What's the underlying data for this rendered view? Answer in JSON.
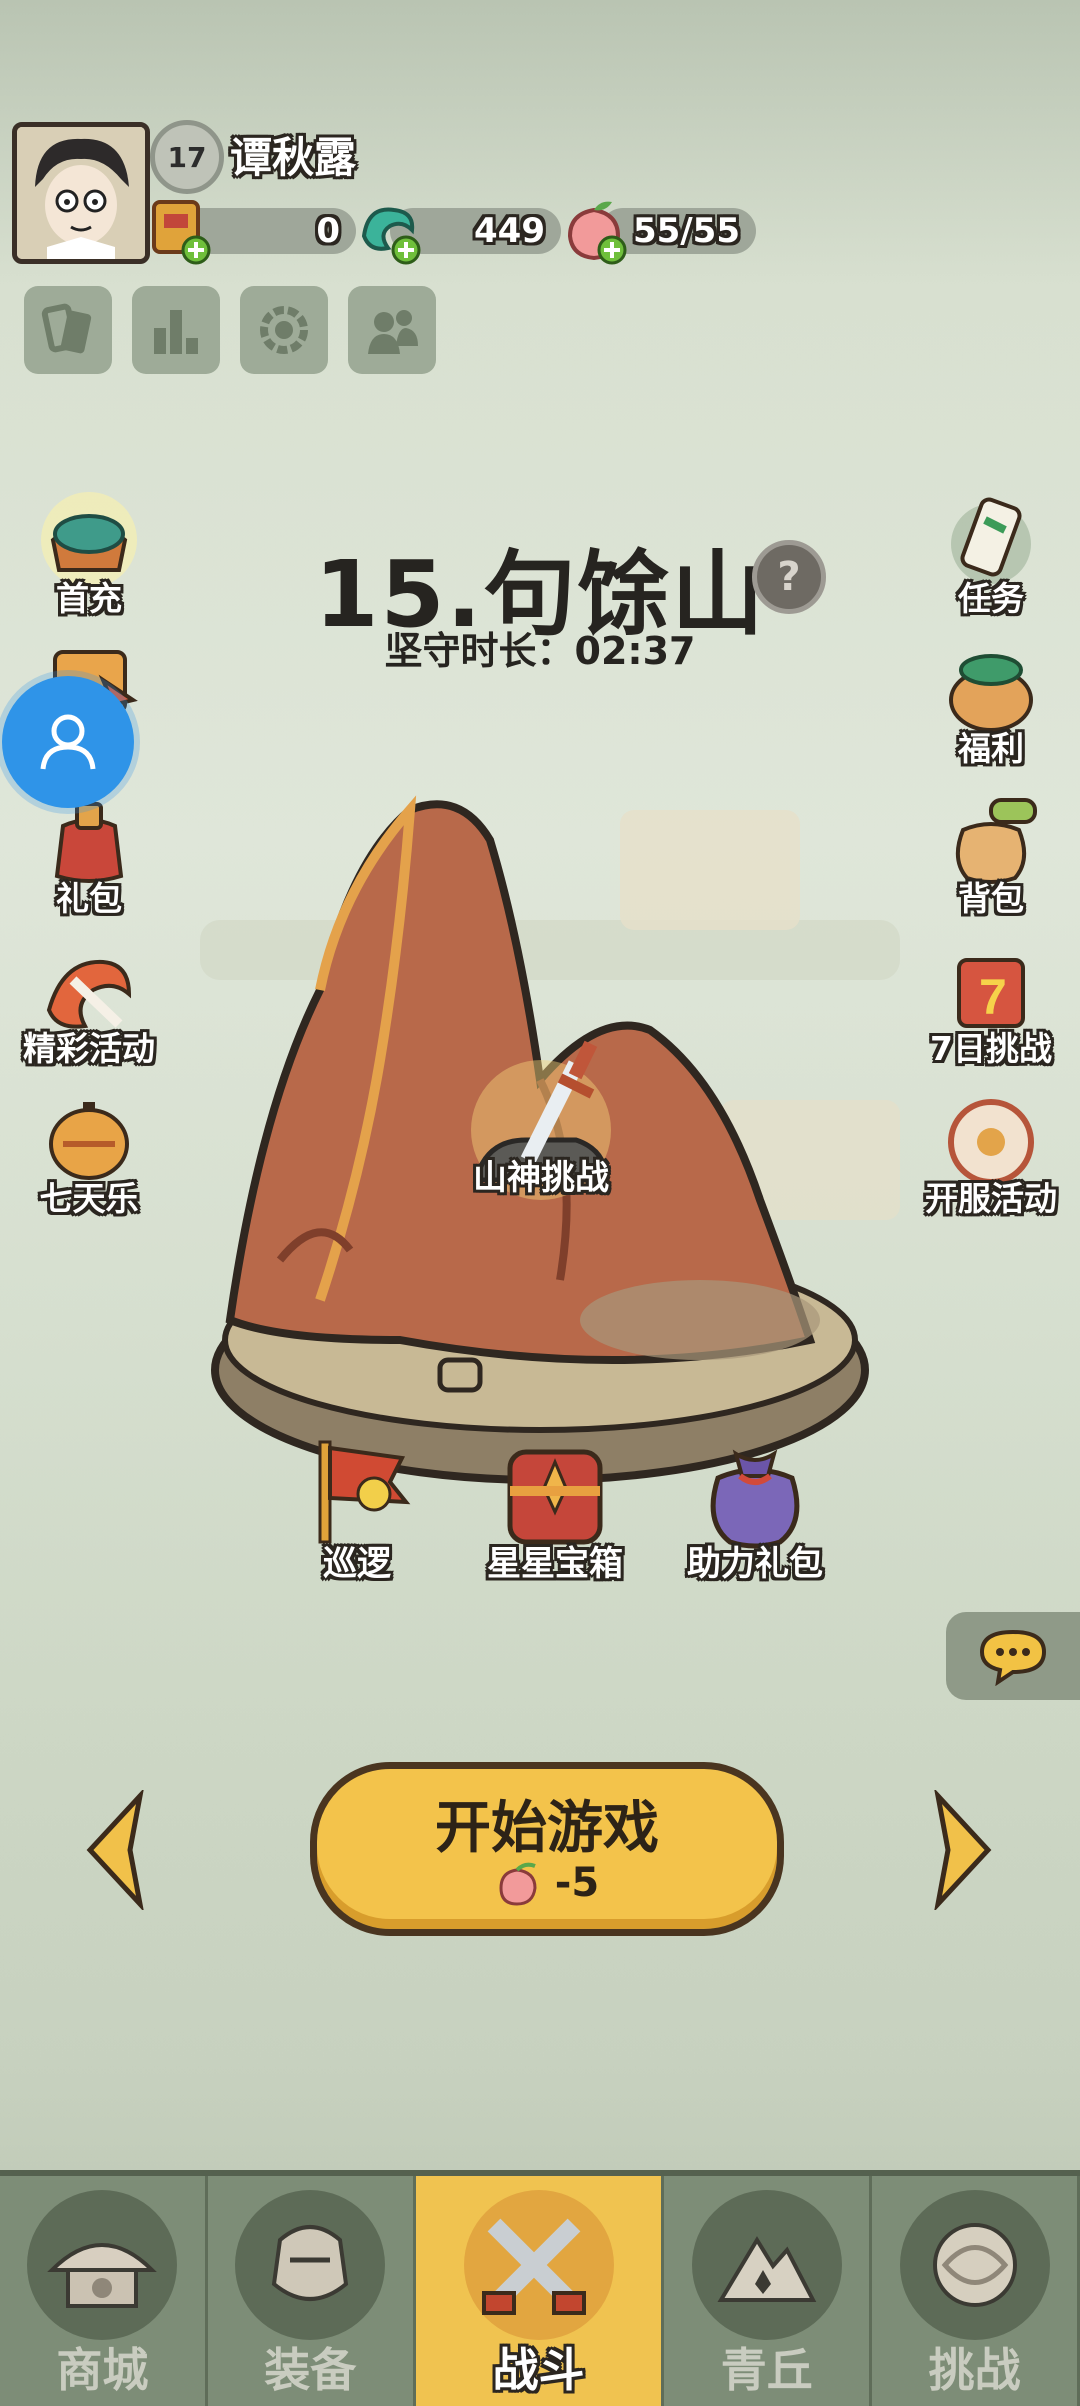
{
  "player": {
    "level": "17",
    "name": "谭秋露"
  },
  "resources": [
    {
      "icon": "gold-ticket-icon",
      "value": "0"
    },
    {
      "icon": "jade-dragon-icon",
      "value": "449"
    },
    {
      "icon": "peach-stamina-icon",
      "value": "55/55"
    }
  ],
  "tools": [
    "cards-icon",
    "ranking-icon",
    "settings-icon",
    "friends-icon"
  ],
  "left_menu": [
    {
      "label": "首充",
      "icon": "first-recharge-icon"
    },
    {
      "label": "",
      "icon": "event-icon"
    },
    {
      "label": "礼包",
      "icon": "gift-bag-icon"
    },
    {
      "label": "精彩活动",
      "icon": "activities-icon"
    },
    {
      "label": "七天乐",
      "icon": "seven-day-icon"
    }
  ],
  "right_menu": [
    {
      "label": "任务",
      "icon": "task-scroll-icon"
    },
    {
      "label": "福利",
      "icon": "welfare-icon"
    },
    {
      "label": "背包",
      "icon": "backpack-icon"
    },
    {
      "label": "7日挑战",
      "icon": "seven-day-challenge-icon"
    },
    {
      "label": "开服活动",
      "icon": "server-event-icon"
    }
  ],
  "stage": {
    "title": "15.句馀山",
    "timer_label": "坚守时长：",
    "timer_value": "02:37",
    "challenge_label": "山神挑战"
  },
  "bottom_items": [
    {
      "label": "巡逻",
      "icon": "patrol-flag-icon"
    },
    {
      "label": "星星宝箱",
      "icon": "star-chest-icon"
    },
    {
      "label": "助力礼包",
      "icon": "support-bag-icon"
    }
  ],
  "start": {
    "label": "开始游戏",
    "cost": "-5"
  },
  "tabs": [
    {
      "label": "商城",
      "icon": "shop-icon",
      "active": false
    },
    {
      "label": "装备",
      "icon": "equipment-icon",
      "active": false
    },
    {
      "label": "战斗",
      "icon": "battle-swords-icon",
      "active": true
    },
    {
      "label": "青丘",
      "icon": "qingqiu-mountain-icon",
      "active": false
    },
    {
      "label": "挑战",
      "icon": "challenge-orb-icon",
      "active": false
    }
  ],
  "colors": {
    "accent": "#f3c34b",
    "outline": "#2b2620",
    "float_button": "#2f94e8",
    "mountain": "#b8694a"
  }
}
